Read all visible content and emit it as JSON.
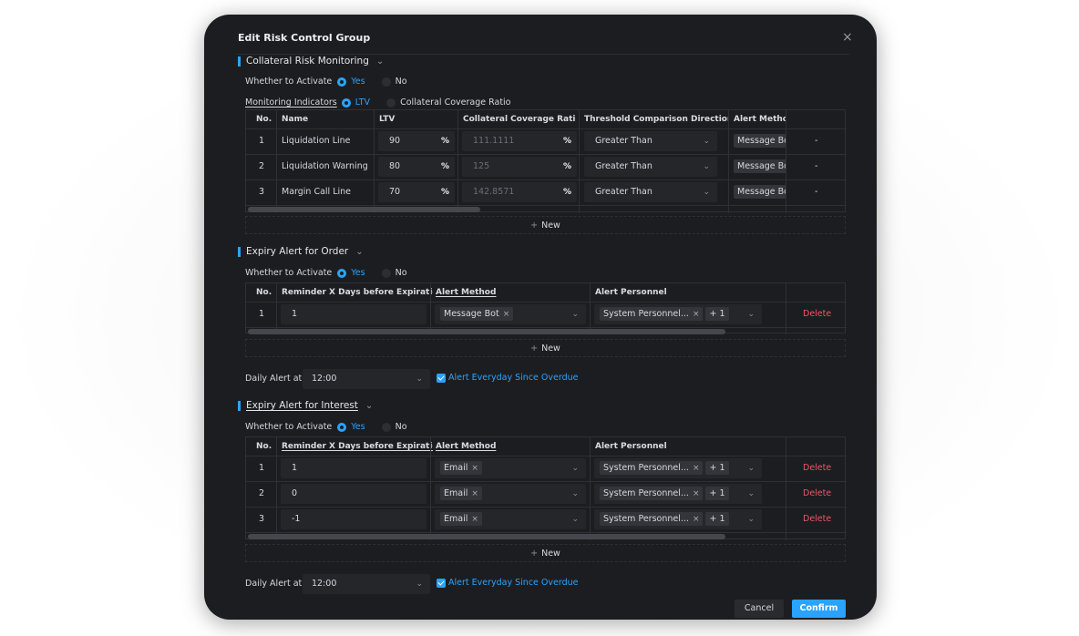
{
  "dialog": {
    "title": "Edit Risk Control Group",
    "close_icon": "×"
  },
  "collateral": {
    "title": "Collateral Risk Monitoring",
    "activate_label": "Whether to Activate",
    "yes": "Yes",
    "no": "No",
    "activated": "Yes",
    "indicators_label": "Monitoring Indicators",
    "indicator_ltv": "LTV",
    "indicator_ccr": "Collateral Coverage Ratio",
    "indicator_selected": "LTV",
    "headers": [
      "No.",
      "Name",
      "LTV",
      "Collateral Coverage Ratio",
      "Threshold Comparison Direction",
      "Alert Method",
      ""
    ],
    "rows": [
      {
        "no": "1",
        "name": "Liquidation Line",
        "ltv": "90",
        "ltv_unit": "%",
        "ccr": "111.1111",
        "ccr_unit": "%",
        "direction": "Greater Than",
        "method": "Message Bot",
        "action": "-"
      },
      {
        "no": "2",
        "name": "Liquidation Warning",
        "ltv": "80",
        "ltv_unit": "%",
        "ccr": "125",
        "ccr_unit": "%",
        "direction": "Greater Than",
        "method": "Message Bot",
        "action": "-"
      },
      {
        "no": "3",
        "name": "Margin Call Line",
        "ltv": "70",
        "ltv_unit": "%",
        "ccr": "142.8571",
        "ccr_unit": "%",
        "direction": "Greater Than",
        "method": "Message Bot",
        "action": "-"
      }
    ],
    "new_label": "New"
  },
  "order": {
    "title": "Expiry Alert for Order",
    "activate_label": "Whether to Activate",
    "yes": "Yes",
    "no": "No",
    "activated": "Yes",
    "headers": [
      "No.",
      "Reminder X Days before Expiration",
      "Alert Method",
      "Alert Personnel",
      ""
    ],
    "rows": [
      {
        "no": "1",
        "days": "1",
        "method": "Message Bot",
        "personnel": "System Personnel...",
        "more": "+ 1",
        "action": "Delete"
      }
    ],
    "new_label": "New",
    "daily_label": "Daily Alert at",
    "daily_time": "12:00",
    "overdue_label": "Alert Everyday Since Overdue",
    "overdue_checked": true
  },
  "interest": {
    "title": "Expiry Alert for Interest",
    "activate_label": "Whether to Activate",
    "yes": "Yes",
    "no": "No",
    "activated": "Yes",
    "headers": [
      "No.",
      "Reminder X Days before Expiration",
      "Alert Method",
      "Alert Personnel",
      ""
    ],
    "rows": [
      {
        "no": "1",
        "days": "1",
        "method": "Email",
        "personnel": "System Personnel...",
        "more": "+ 1",
        "action": "Delete"
      },
      {
        "no": "2",
        "days": "0",
        "method": "Email",
        "personnel": "System Personnel...",
        "more": "+ 1",
        "action": "Delete"
      },
      {
        "no": "3",
        "days": "-1",
        "method": "Email",
        "personnel": "System Personnel...",
        "more": "+ 1",
        "action": "Delete"
      }
    ],
    "new_label": "New",
    "daily_label": "Daily Alert at",
    "daily_time": "12:00",
    "overdue_label": "Alert Everyday Since Overdue",
    "overdue_checked": true
  },
  "footer": {
    "cancel": "Cancel",
    "confirm": "Confirm"
  },
  "colors": {
    "accent": "#2aa3ff",
    "danger": "#f0566a",
    "modal_bg": "#1c1d20"
  }
}
